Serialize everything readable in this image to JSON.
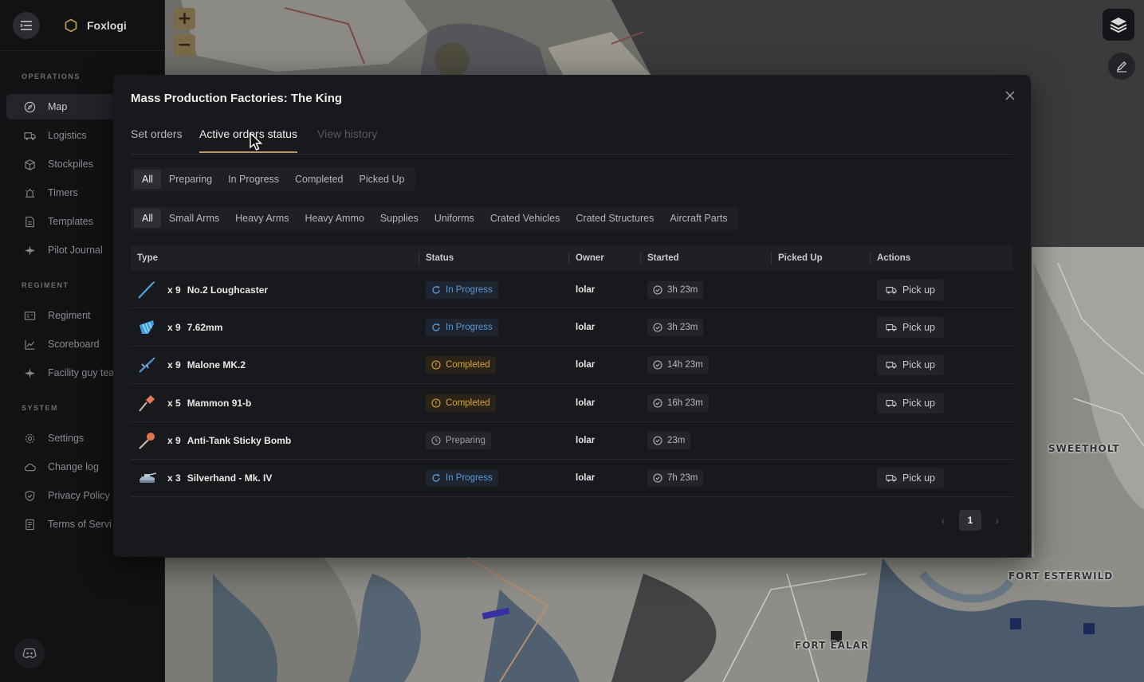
{
  "app": {
    "brand": "Foxlogi"
  },
  "sidebar": {
    "sections": [
      {
        "title": "OPERATIONS",
        "items": [
          {
            "label": "Map",
            "icon": "compass-icon"
          },
          {
            "label": "Logistics",
            "icon": "truck-icon"
          },
          {
            "label": "Stockpiles",
            "icon": "box-icon"
          },
          {
            "label": "Timers",
            "icon": "alarm-icon"
          },
          {
            "label": "Templates",
            "icon": "file-icon"
          },
          {
            "label": "Pilot Journal",
            "icon": "plane-icon"
          }
        ]
      },
      {
        "title": "REGIMENT",
        "items": [
          {
            "label": "Regiment",
            "icon": "id-card-icon"
          },
          {
            "label": "Scoreboard",
            "icon": "chart-line-icon"
          },
          {
            "label": "Facility guy tea",
            "icon": "plane-icon"
          }
        ]
      },
      {
        "title": "SYSTEM",
        "items": [
          {
            "label": "Settings",
            "icon": "gear-icon"
          },
          {
            "label": "Change log",
            "icon": "cloud-icon"
          },
          {
            "label": "Privacy Policy",
            "icon": "shield-icon"
          },
          {
            "label": "Terms of Servi",
            "icon": "document-icon"
          }
        ]
      }
    ],
    "active": "Map"
  },
  "map": {
    "zoom_in": "+",
    "zoom_out": "−",
    "labels": [
      "SWEETHOLT",
      "FORT ESTERWILD",
      "FORT EALAR"
    ]
  },
  "modal": {
    "title": "Mass Production Factories: The King",
    "tabs": [
      "Set orders",
      "Active orders status",
      "View history"
    ],
    "active_tab": "Active orders status",
    "status_filters": [
      "All",
      "Preparing",
      "In Progress",
      "Completed",
      "Picked Up"
    ],
    "category_filters": [
      "All",
      "Small Arms",
      "Heavy Arms",
      "Heavy Ammo",
      "Supplies",
      "Uniforms",
      "Crated Vehicles",
      "Crated Structures",
      "Aircraft Parts"
    ],
    "columns": [
      "Type",
      "Status",
      "Owner",
      "Started",
      "Picked Up",
      "Actions"
    ],
    "rows": [
      {
        "qty": "x 9",
        "name": "No.2 Loughcaster",
        "status": "In Progress",
        "owner": "lolar",
        "started": "3h 23m",
        "picked_up": "",
        "action": "Pick up",
        "icon": "rifle-icon"
      },
      {
        "qty": "x 9",
        "name": "7.62mm",
        "status": "In Progress",
        "owner": "lolar",
        "started": "3h 23m",
        "picked_up": "",
        "action": "Pick up",
        "icon": "ammo-icon"
      },
      {
        "qty": "x 9",
        "name": "Malone MK.2",
        "status": "Completed",
        "owner": "lolar",
        "started": "14h 23m",
        "picked_up": "",
        "action": "Pick up",
        "icon": "machine-gun-icon"
      },
      {
        "qty": "x 5",
        "name": "Mammon 91-b",
        "status": "Completed",
        "owner": "lolar",
        "started": "16h 23m",
        "picked_up": "",
        "action": "Pick up",
        "icon": "grenade-icon"
      },
      {
        "qty": "x 9",
        "name": "Anti-Tank Sticky Bomb",
        "status": "Preparing",
        "owner": "lolar",
        "started": "23m",
        "picked_up": "",
        "action": "",
        "icon": "sticky-bomb-icon"
      },
      {
        "qty": "x 3",
        "name": "Silverhand - Mk. IV",
        "status": "In Progress",
        "owner": "lolar",
        "started": "7h 23m",
        "picked_up": "",
        "action": "Pick up",
        "icon": "tank-icon"
      }
    ],
    "pagination": {
      "current": "1"
    }
  },
  "colors": {
    "accent": "#b49a6a",
    "in_progress": "#5b9bd8",
    "completed": "#d9a43d"
  }
}
